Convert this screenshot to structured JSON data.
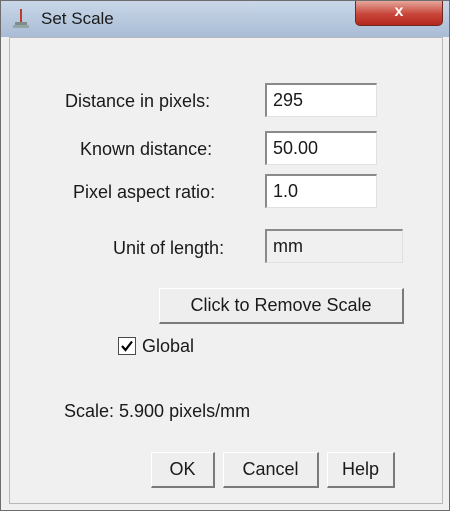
{
  "window": {
    "title": "Set Scale",
    "close_label": "x"
  },
  "form": {
    "distance_pixels": {
      "label": "Distance in pixels:",
      "value": "295"
    },
    "known_distance": {
      "label": "Known distance:",
      "value": "50.00"
    },
    "pixel_aspect_ratio": {
      "label": "Pixel aspect ratio:",
      "value": "1.0"
    },
    "unit_of_length": {
      "label": "Unit of length:",
      "value": "mm"
    }
  },
  "remove_scale_button": "Click to Remove Scale",
  "global": {
    "label": "Global",
    "checked": true
  },
  "scale_text": "Scale: 5.900 pixels/mm",
  "buttons": {
    "ok": "OK",
    "cancel": "Cancel",
    "help": "Help"
  },
  "icons": [
    "app-icon",
    "close-icon",
    "checkmark-icon"
  ]
}
